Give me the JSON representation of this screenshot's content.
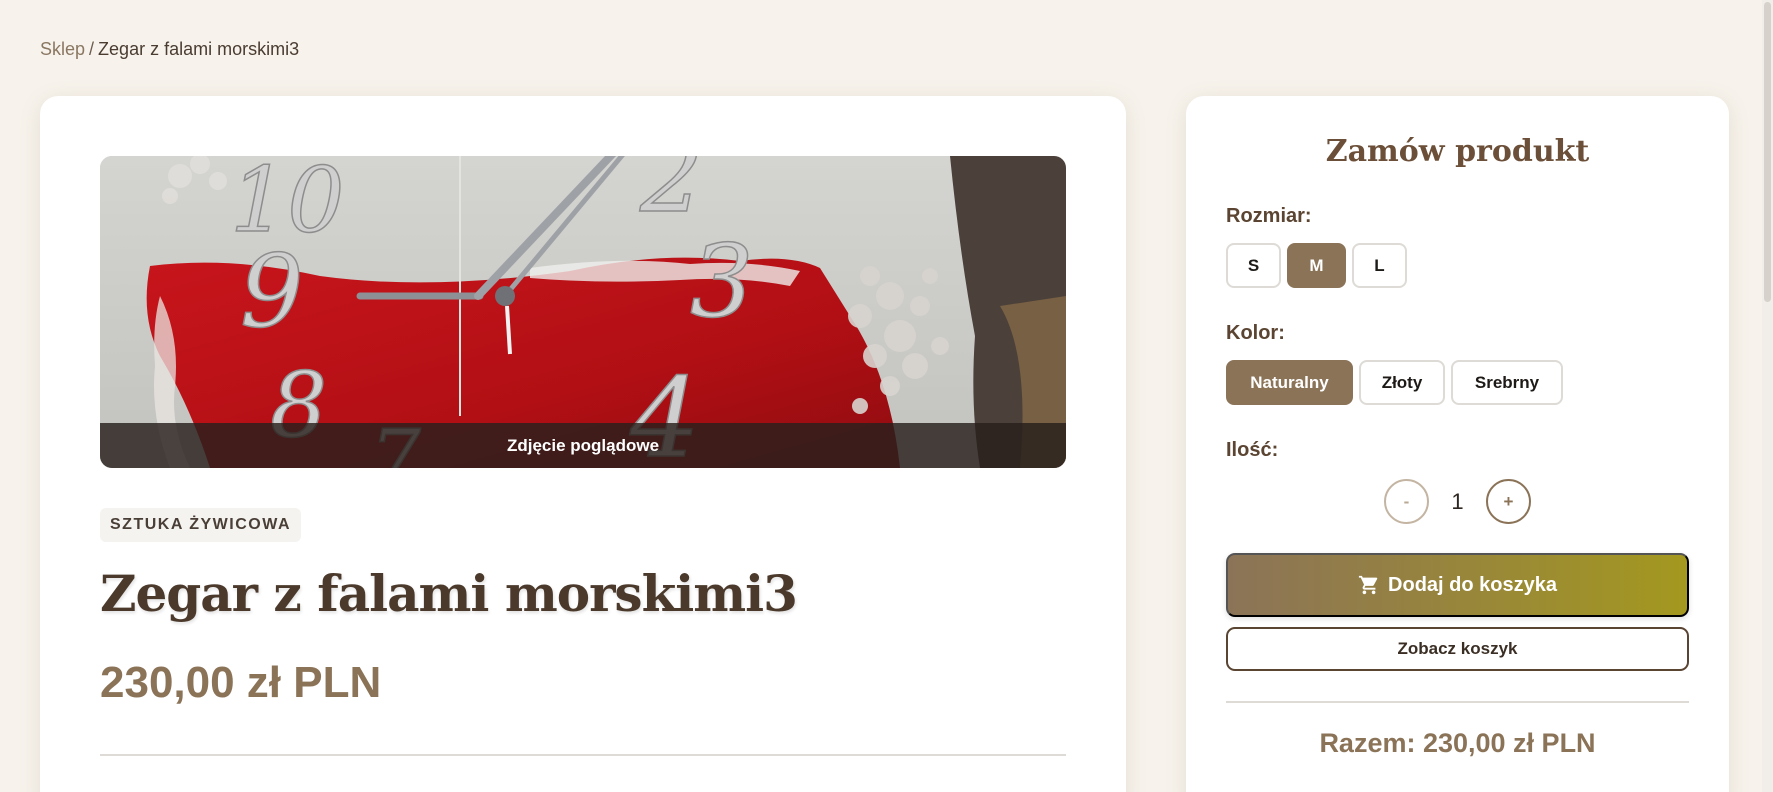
{
  "breadcrumb": {
    "shop": "Sklep",
    "separator": "/",
    "current": "Zegar z falami morskimi3"
  },
  "product": {
    "image_caption": "Zdjęcie poglądowe",
    "category": "SZTUKA ŻYWICOWA",
    "title": "Zegar z falami morskimi3",
    "price": "230,00 zł PLN"
  },
  "order": {
    "title": "Zamów produkt",
    "size_label": "Rozmiar:",
    "sizes": [
      "S",
      "M",
      "L"
    ],
    "selected_size": "M",
    "color_label": "Kolor:",
    "colors": [
      "Naturalny",
      "Złoty",
      "Srebrny"
    ],
    "selected_color": "Naturalny",
    "qty_label": "Ilość:",
    "qty_minus": "-",
    "qty_value": "1",
    "qty_plus": "+",
    "add_to_cart": "Dodaj do koszyka",
    "view_cart": "Zobacz koszyk",
    "total": "Razem: 230,00 zł PLN"
  },
  "clock_numerals": [
    "10",
    "9",
    "8",
    "7",
    "2",
    "3",
    "4"
  ],
  "colors": {
    "accent": "#8b7358",
    "accent_end": "#a4981f",
    "heading": "#4b3a2c",
    "background": "#f7f3ec"
  },
  "icons": {
    "cart": "shopping-cart-icon"
  }
}
